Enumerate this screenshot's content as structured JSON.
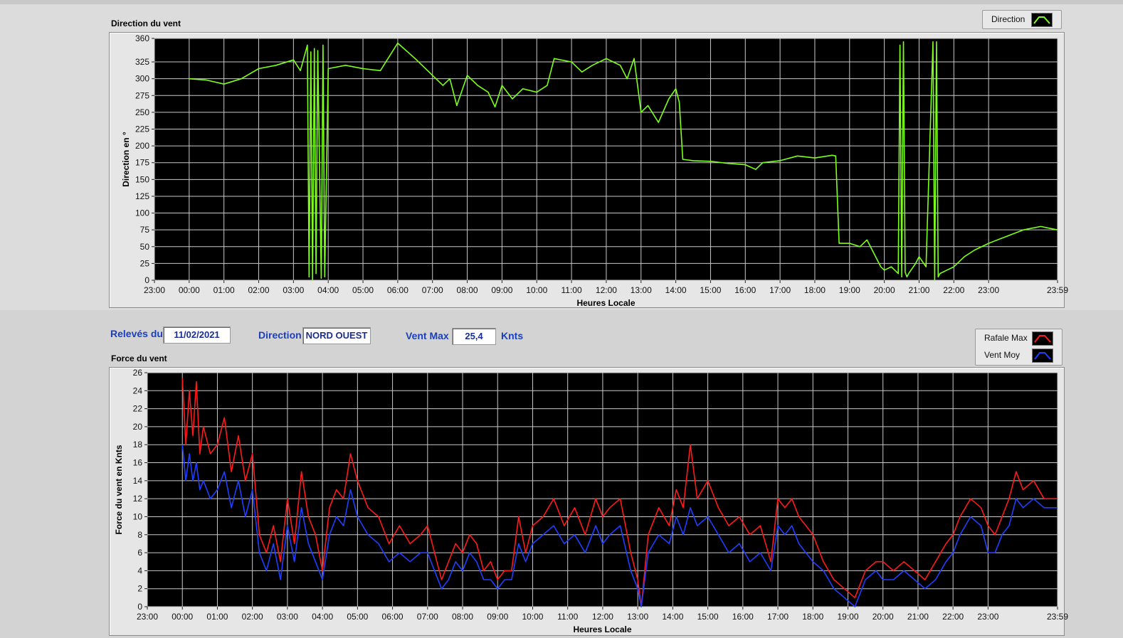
{
  "top_chart": {
    "section_title": "Direction du vent",
    "legend": [
      {
        "label": "Direction",
        "color": "#7cff1a"
      }
    ]
  },
  "bottom_chart": {
    "section_title": "Force du vent",
    "legend": [
      {
        "label": "Rafale Max",
        "color": "#ff1a1a"
      },
      {
        "label": "Vent Moy",
        "color": "#1f3fff"
      }
    ]
  },
  "info": {
    "releves_label": "Relevés du",
    "date_value": "11/02/2021",
    "direction_label": "Direction",
    "direction_value": "NORD OUEST",
    "vent_max_label": "Vent Max",
    "vent_max_value": "25,4",
    "unit_label": "Knts"
  },
  "chart_data": [
    {
      "type": "line",
      "title": "Direction du vent",
      "xlabel": "Heures Locale",
      "ylabel": "Direction en °",
      "xlim": [
        -1,
        24.983
      ],
      "ylim": [
        0,
        360
      ],
      "x_ticks": [
        "23:00",
        "00:00",
        "01:00",
        "02:00",
        "03:00",
        "04:00",
        "05:00",
        "06:00",
        "07:00",
        "08:00",
        "09:00",
        "10:00",
        "11:00",
        "12:00",
        "13:00",
        "14:00",
        "15:00",
        "16:00",
        "17:00",
        "18:00",
        "19:00",
        "20:00",
        "21:00",
        "22:00",
        "23:00",
        "23:59"
      ],
      "y_ticks": [
        0,
        25,
        50,
        75,
        100,
        125,
        150,
        175,
        200,
        225,
        250,
        275,
        300,
        325,
        360
      ],
      "grid": true,
      "legend_position": "top-right",
      "series": [
        {
          "name": "Direction",
          "color": "#7cff1a",
          "x": [
            0,
            0.5,
            1,
            1.5,
            2,
            2.5,
            3,
            3.2,
            3.4,
            3.45,
            3.5,
            3.55,
            3.6,
            3.65,
            3.7,
            3.8,
            3.85,
            3.9,
            4,
            4.5,
            5,
            5.5,
            6,
            6.5,
            7,
            7.3,
            7.5,
            7.7,
            8,
            8.3,
            8.6,
            8.8,
            9,
            9.3,
            9.6,
            10,
            10.3,
            10.5,
            11,
            11.3,
            11.6,
            12,
            12.2,
            12.4,
            12.6,
            12.8,
            13,
            13.2,
            13.5,
            13.8,
            14,
            14.1,
            14.2,
            14.5,
            15,
            15.5,
            16,
            16.3,
            16.5,
            17,
            17.5,
            18,
            18.5,
            18.6,
            18.7,
            19,
            19.3,
            19.5,
            19.7,
            19.9,
            20,
            20.2,
            20.4,
            20.45,
            20.5,
            20.55,
            20.6,
            20.65,
            20.7,
            20.9,
            21,
            21.2,
            21.4,
            21.45,
            21.5,
            21.55,
            21.6,
            21.8,
            22,
            22.3,
            22.6,
            23,
            23.5,
            24,
            24.5,
            24.98
          ],
          "y": [
            300,
            298,
            292,
            300,
            315,
            320,
            328,
            312,
            350,
            5,
            340,
            0,
            345,
            10,
            342,
            3,
            350,
            5,
            315,
            320,
            315,
            312,
            353,
            330,
            305,
            290,
            300,
            260,
            305,
            290,
            280,
            258,
            290,
            270,
            285,
            280,
            290,
            330,
            325,
            310,
            320,
            330,
            325,
            320,
            300,
            330,
            250,
            260,
            235,
            270,
            285,
            265,
            180,
            178,
            177,
            174,
            172,
            165,
            175,
            178,
            185,
            182,
            186,
            185,
            55,
            55,
            50,
            60,
            40,
            20,
            15,
            20,
            10,
            350,
            5,
            355,
            12,
            5,
            10,
            25,
            35,
            20,
            355,
            0,
            355,
            5,
            10,
            15,
            20,
            35,
            45,
            55,
            65,
            75,
            80,
            75
          ]
        }
      ]
    },
    {
      "type": "line",
      "title": "Force du vent",
      "xlabel": "Heures Locale",
      "ylabel": "Force du vent en Knts",
      "xlim": [
        -1,
        24.983
      ],
      "ylim": [
        0,
        26
      ],
      "x_ticks": [
        "23:00",
        "00:00",
        "01:00",
        "02:00",
        "03:00",
        "04:00",
        "05:00",
        "06:00",
        "07:00",
        "08:00",
        "09:00",
        "10:00",
        "11:00",
        "12:00",
        "13:00",
        "14:00",
        "15:00",
        "16:00",
        "17:00",
        "18:00",
        "19:00",
        "20:00",
        "21:00",
        "22:00",
        "23:00",
        "23:59"
      ],
      "y_ticks": [
        0,
        2,
        4,
        6,
        8,
        10,
        12,
        14,
        16,
        18,
        20,
        22,
        24,
        26
      ],
      "grid": true,
      "legend_position": "top-right",
      "series": [
        {
          "name": "Rafale Max",
          "color": "#ff1a1a",
          "x": [
            0,
            0.1,
            0.2,
            0.3,
            0.4,
            0.5,
            0.6,
            0.8,
            1,
            1.2,
            1.4,
            1.6,
            1.8,
            2,
            2.2,
            2.4,
            2.6,
            2.8,
            3,
            3.2,
            3.4,
            3.6,
            3.8,
            4,
            4.2,
            4.4,
            4.6,
            4.8,
            5,
            5.3,
            5.6,
            5.9,
            6.2,
            6.5,
            6.8,
            7,
            7.2,
            7.4,
            7.6,
            7.8,
            8,
            8.2,
            8.4,
            8.6,
            8.8,
            9,
            9.2,
            9.4,
            9.6,
            9.8,
            10,
            10.3,
            10.6,
            10.9,
            11.2,
            11.5,
            11.8,
            12,
            12.2,
            12.5,
            12.8,
            13,
            13.1,
            13.3,
            13.6,
            13.9,
            14.1,
            14.3,
            14.5,
            14.7,
            15,
            15.3,
            15.6,
            15.9,
            16.2,
            16.5,
            16.8,
            17,
            17.2,
            17.4,
            17.6,
            17.8,
            18,
            18.3,
            18.6,
            18.9,
            19.2,
            19.5,
            19.8,
            20,
            20.3,
            20.6,
            20.9,
            21.2,
            21.5,
            21.8,
            22,
            22.2,
            22.5,
            22.8,
            23,
            23.2,
            23.4,
            23.6,
            23.8,
            24,
            24.3,
            24.6,
            24.98
          ],
          "y": [
            25.4,
            18,
            24,
            19,
            25,
            17,
            20,
            17,
            18,
            21,
            15,
            19,
            14,
            17,
            8,
            6,
            9,
            5,
            12,
            7,
            15,
            10,
            8,
            4,
            11,
            13,
            12,
            17,
            14,
            11,
            10,
            7,
            9,
            7,
            8,
            9,
            6,
            3,
            5,
            7,
            6,
            8,
            7,
            4,
            5,
            3,
            4,
            4,
            10,
            6,
            9,
            10,
            12,
            9,
            11,
            8,
            12,
            10,
            11,
            12,
            6,
            3,
            0,
            8,
            11,
            9,
            13,
            11,
            18,
            12,
            14,
            11,
            9,
            10,
            8,
            9,
            5,
            12,
            11,
            12,
            10,
            9,
            8,
            5,
            3,
            2,
            1,
            4,
            5,
            5,
            4,
            5,
            4,
            3,
            5,
            7,
            8,
            10,
            12,
            11,
            9,
            8,
            10,
            12,
            15,
            13,
            14,
            12,
            12
          ]
        },
        {
          "name": "Vent Moy",
          "color": "#1f3fff",
          "x": [
            0,
            0.1,
            0.2,
            0.3,
            0.4,
            0.5,
            0.6,
            0.8,
            1,
            1.2,
            1.4,
            1.6,
            1.8,
            2,
            2.2,
            2.4,
            2.6,
            2.8,
            3,
            3.2,
            3.4,
            3.6,
            3.8,
            4,
            4.2,
            4.4,
            4.6,
            4.8,
            5,
            5.3,
            5.6,
            5.9,
            6.2,
            6.5,
            6.8,
            7,
            7.2,
            7.4,
            7.6,
            7.8,
            8,
            8.2,
            8.4,
            8.6,
            8.8,
            9,
            9.2,
            9.4,
            9.6,
            9.8,
            10,
            10.3,
            10.6,
            10.9,
            11.2,
            11.5,
            11.8,
            12,
            12.2,
            12.5,
            12.8,
            13,
            13.1,
            13.3,
            13.6,
            13.9,
            14.1,
            14.3,
            14.5,
            14.7,
            15,
            15.3,
            15.6,
            15.9,
            16.2,
            16.5,
            16.8,
            17,
            17.2,
            17.4,
            17.6,
            17.8,
            18,
            18.3,
            18.6,
            18.9,
            19.2,
            19.5,
            19.8,
            20,
            20.3,
            20.6,
            20.9,
            21.2,
            21.5,
            21.8,
            22,
            22.2,
            22.5,
            22.8,
            23,
            23.2,
            23.4,
            23.6,
            23.8,
            24,
            24.3,
            24.6,
            24.98
          ],
          "y": [
            18,
            14,
            17,
            14,
            16,
            13,
            14,
            12,
            13,
            15,
            11,
            14,
            10,
            13,
            6,
            4,
            7,
            3,
            9,
            5,
            11,
            7,
            5,
            3,
            8,
            10,
            9,
            13,
            10,
            8,
            7,
            5,
            6,
            5,
            6,
            6,
            4,
            2,
            3,
            5,
            4,
            6,
            5,
            3,
            3,
            2,
            3,
            3,
            7,
            5,
            7,
            8,
            9,
            7,
            8,
            6,
            9,
            7,
            8,
            9,
            4,
            2,
            0,
            6,
            8,
            7,
            10,
            8,
            11,
            9,
            10,
            8,
            6,
            7,
            5,
            6,
            4,
            9,
            8,
            9,
            7,
            6,
            5,
            4,
            2,
            1,
            0,
            3,
            4,
            3,
            3,
            4,
            3,
            2,
            3,
            5,
            6,
            8,
            10,
            9,
            6,
            6,
            8,
            9,
            12,
            11,
            12,
            11,
            11
          ]
        }
      ]
    }
  ]
}
